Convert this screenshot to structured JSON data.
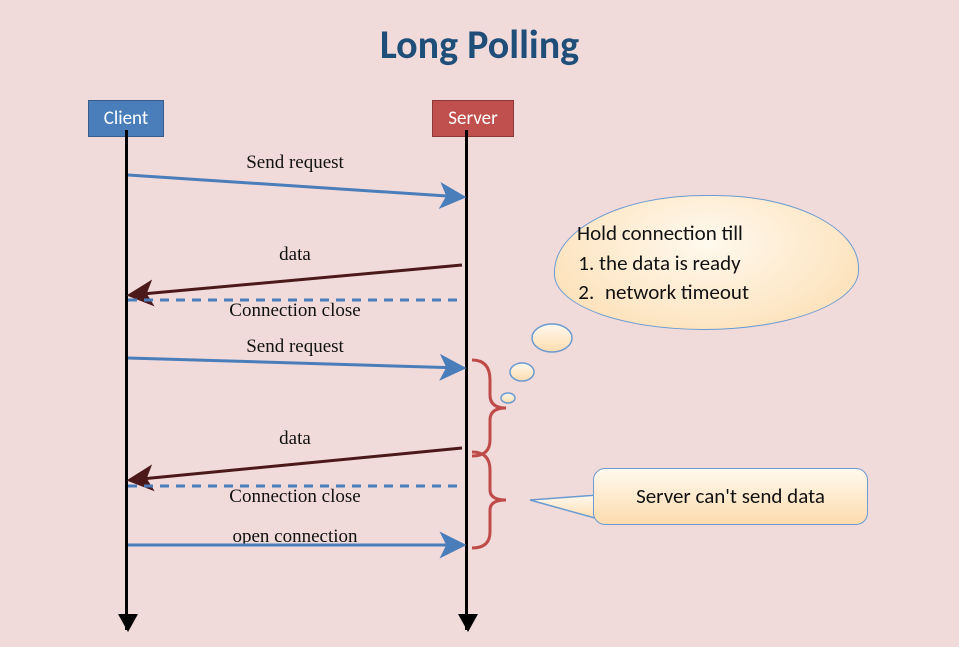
{
  "title": "Long Polling",
  "actors": {
    "client": "Client",
    "server": "Server"
  },
  "messages": {
    "m1": "Send request",
    "m2": "data",
    "m3": "Connection close",
    "m4": "Send request",
    "m5": "data",
    "m6": "Connection close",
    "m7": "open connection"
  },
  "callouts": {
    "hold_title": "Hold connection till",
    "hold_item1": "the data is ready",
    "hold_item2": "network timeout",
    "no_send": "Server can't send data"
  },
  "colors": {
    "title": "#1f4e79",
    "client_box": "#4a7ebb",
    "server_box": "#c0504d",
    "blue_arrow": "#4a7ebb",
    "dark_arrow": "#4b1919",
    "bracket": "#be4b48",
    "callout_border": "#6a9bd1",
    "callout_fill_top": "#fff9ee",
    "callout_fill_bottom": "#fcdcae"
  }
}
